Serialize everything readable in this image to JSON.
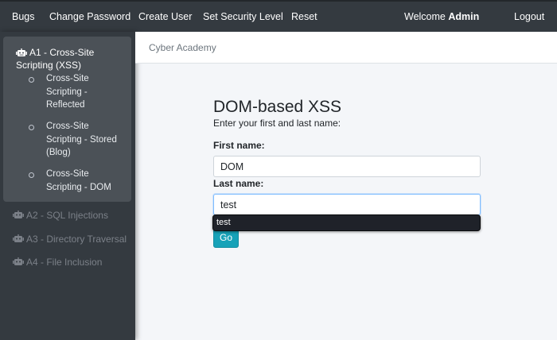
{
  "navbar": {
    "items": [
      "Bugs",
      "Change Password",
      "Create User",
      "Set Security Level",
      "Reset"
    ],
    "welcome_prefix": "Welcome",
    "welcome_user": "Admin",
    "logout": "Logout"
  },
  "sidebar": {
    "active_group": {
      "icon": "robot-icon",
      "title": "A1 - Cross-Site Scripting (XSS)",
      "items": [
        "Cross-Site Scripting - Reflected",
        "Cross-Site Scripting - Stored (Blog)",
        "Cross-Site Scripting - DOM"
      ]
    },
    "groups": [
      "A2 - SQL Injections",
      "A3 - Directory Traversal",
      "A4 - File Inclusion"
    ]
  },
  "header": {
    "brand": "Cyber Academy"
  },
  "main": {
    "title": "DOM-based XSS",
    "subtitle": "Enter your first and last name:",
    "first_name_label": "First name:",
    "first_name_value": "DOM",
    "last_name_label": "Last name:",
    "last_name_value": "test",
    "autocomplete_suggestion": "test",
    "go_button": "Go"
  },
  "colors": {
    "navbar_bg": "#343a40",
    "sidebar_bg": "#343a40",
    "sidebar_active_bg": "#4b5157",
    "button_bg": "#17a2b8",
    "page_bg": "#f4f6f9"
  }
}
